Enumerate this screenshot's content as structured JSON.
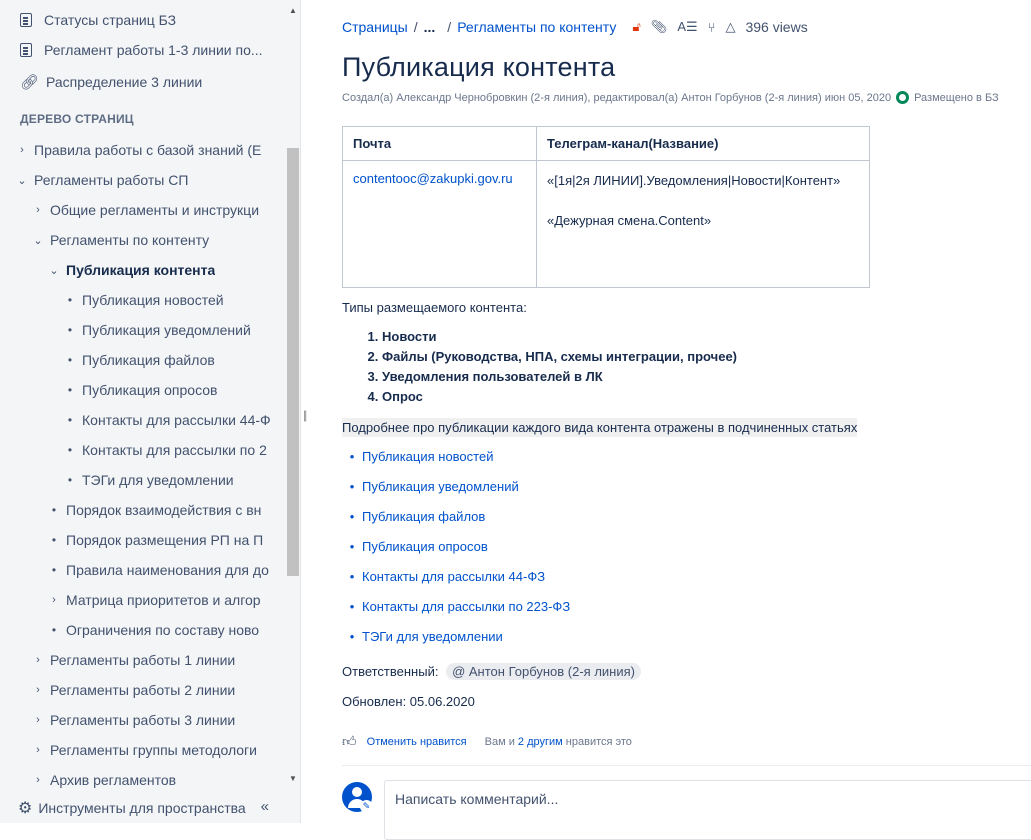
{
  "sidebar": {
    "top_items": [
      {
        "label": "Статусы страниц БЗ",
        "icon": "page-icon"
      },
      {
        "label": "Регламент работы 1-3 линии по...",
        "icon": "page-icon"
      },
      {
        "label": "Распределение 3 линии",
        "icon": "link-icon"
      }
    ],
    "tree_heading": "ДЕРЕВО СТРАНИЦ",
    "tree": [
      {
        "label": "Правила работы с базой знаний (Е",
        "marker": "›"
      },
      {
        "label": "Регламенты работы СП",
        "marker": "⌄"
      },
      {
        "label": "Общие регламенты и инструкци",
        "marker": "›"
      },
      {
        "label": "Регламенты по контенту",
        "marker": "⌄"
      },
      {
        "label": "Публикация контента",
        "marker": "⌄"
      },
      {
        "label": "Публикация новостей",
        "marker": "•"
      },
      {
        "label": "Публикация уведомлений",
        "marker": "•"
      },
      {
        "label": "Публикация файлов",
        "marker": "•"
      },
      {
        "label": "Публикация опросов",
        "marker": "•"
      },
      {
        "label": "Контакты для рассылки 44-Ф",
        "marker": "•"
      },
      {
        "label": "Контакты для рассылки по 2",
        "marker": "•"
      },
      {
        "label": "ТЭГи для уведомлении",
        "marker": "•"
      },
      {
        "label": "Порядок взаимодействия с вн",
        "marker": "•"
      },
      {
        "label": "Порядок размещения РП на П",
        "marker": "•"
      },
      {
        "label": "Правила наименования для до",
        "marker": "•"
      },
      {
        "label": "Матрица приоритетов и алгор",
        "marker": "›"
      },
      {
        "label": "Ограничения по составу ново",
        "marker": "•"
      },
      {
        "label": "Регламенты работы 1 линии",
        "marker": "›"
      },
      {
        "label": "Регламенты работы 2 линии",
        "marker": "›"
      },
      {
        "label": "Регламенты работы 3 линии",
        "marker": "›"
      },
      {
        "label": "Регламенты группы методологи",
        "marker": "›"
      },
      {
        "label": "Архив регламентов",
        "marker": "›"
      }
    ],
    "footer_label": "Инструменты для пространства",
    "collapse_glyph": "«"
  },
  "breadcrumbs": {
    "root": "Страницы",
    "ellipsis": "...",
    "parent": "Регламенты по контенту",
    "views": "396 views"
  },
  "page": {
    "title": "Публикация контента",
    "byline": "Создал(а) Александр Чернобровкин (2-я линия), редактировал(а) Антон Горбунов (2-я линия) июн 05, 2020",
    "status": "Размещено в БЗ"
  },
  "table": {
    "headers": [
      "Почта",
      "Телеграм-канал(Название)"
    ],
    "email": "contentooc@zakupki.gov.ru",
    "channel_1": "«[1я|2я ЛИНИИ].Уведомления|Новости|Контент»",
    "channel_2": "«Дежурная смена.Content»"
  },
  "content": {
    "types_heading": "Типы размещаемого контента:",
    "types": [
      "Новости",
      "Файлы (Руководства, НПА, схемы интеграции, прочее)",
      "Уведомления пользователей в ЛК",
      "Опрос"
    ],
    "more_text": "Подробнее про публикации каждого вида контента отражены в подчиненных статьях",
    "links": [
      "Публикация новостей",
      "Публикация уведомлений",
      "Публикация файлов",
      "Публикация опросов",
      "Контакты для рассылки 44-ФЗ",
      "Контакты для рассылки по 223-ФЗ",
      "ТЭГи для уведомлении"
    ],
    "responsible_label": "Ответственный:",
    "responsible_user": "@ Антон Горбунов (2-я линия)",
    "updated": "Обновлен: 05.06.2020"
  },
  "likes": {
    "unlike_label": "Отменить нравится",
    "summary_prefix": "Вам и",
    "summary_link": "2 другим",
    "summary_suffix": "нравится это"
  },
  "comment": {
    "placeholder": "Написать комментарий..."
  }
}
